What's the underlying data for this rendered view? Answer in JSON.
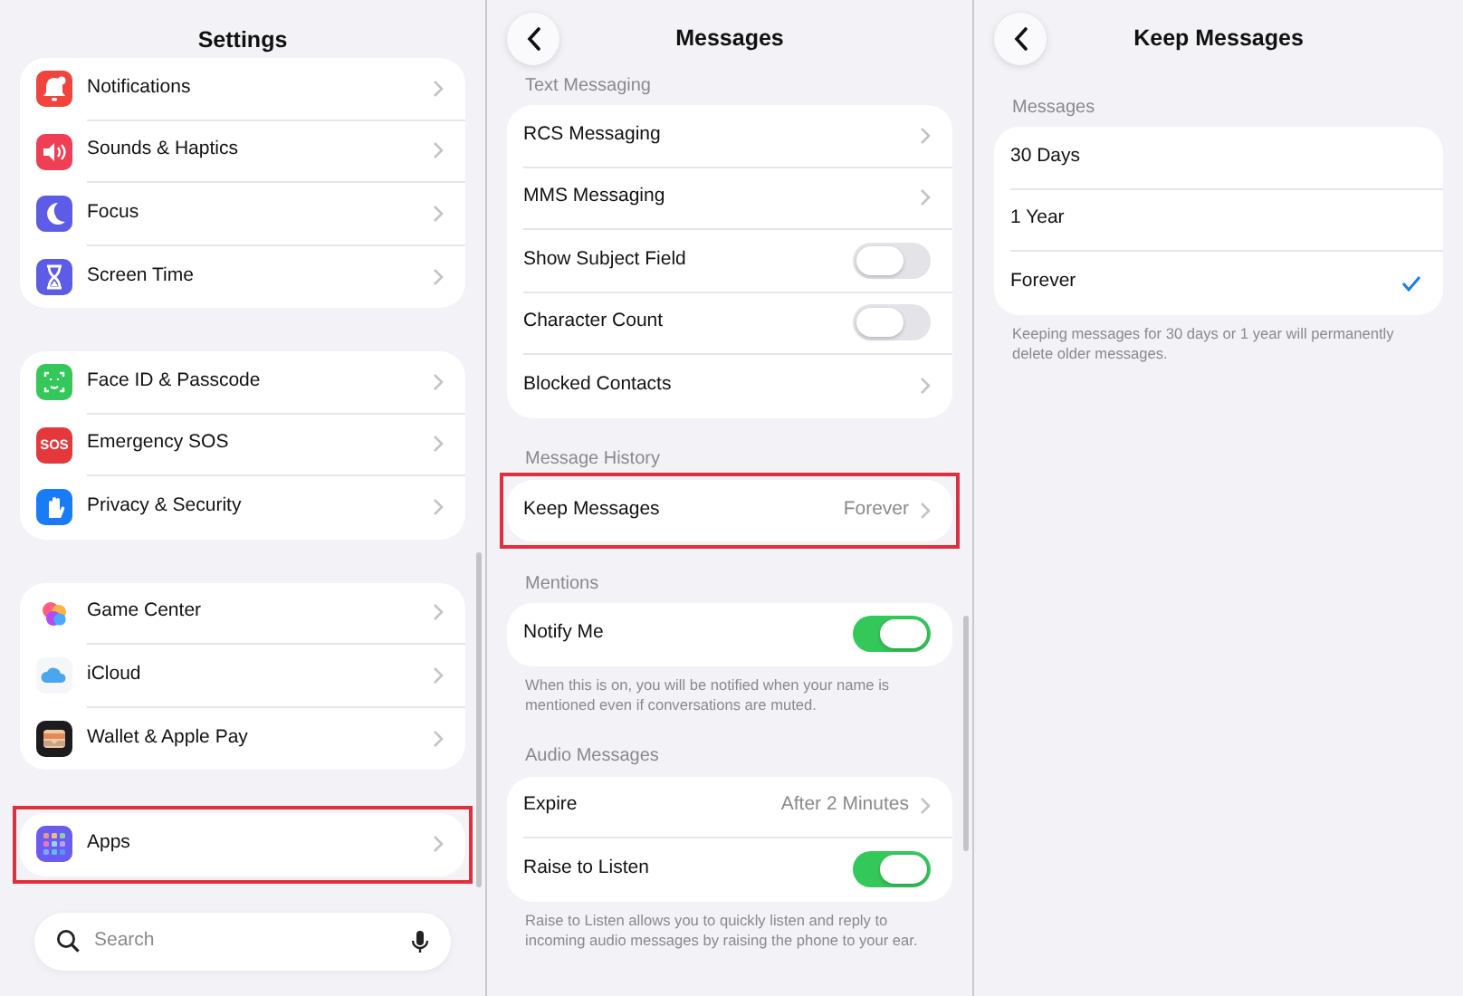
{
  "panels": [
    {
      "title": "Settings",
      "back_button": false,
      "groups": [
        {
          "highlighted": false,
          "rows": [
            {
              "label": "Notifications",
              "kind": "link"
            },
            {
              "label": "Sounds & Haptics",
              "kind": "link"
            },
            {
              "label": "Focus",
              "kind": "link"
            },
            {
              "label": "Screen Time",
              "kind": "link"
            }
          ]
        },
        {
          "highlighted": false,
          "rows": [
            {
              "label": "Face ID & Passcode",
              "kind": "link"
            },
            {
              "label": "Emergency SOS",
              "kind": "link",
              "icon_label": "SOS"
            },
            {
              "label": "Privacy & Security",
              "kind": "link"
            }
          ]
        },
        {
          "highlighted": false,
          "rows": [
            {
              "label": "Game Center",
              "kind": "link"
            },
            {
              "label": "iCloud",
              "kind": "link"
            },
            {
              "label": "Wallet & Apple Pay",
              "kind": "link"
            }
          ]
        },
        {
          "highlighted": true,
          "rows": [
            {
              "label": "Apps",
              "kind": "link"
            }
          ]
        }
      ],
      "search": {
        "placeholder": "Search"
      }
    },
    {
      "title": "Messages",
      "back_button": true,
      "groups": [
        {
          "header": "Text Messaging",
          "rows": [
            {
              "label": "RCS Messaging",
              "kind": "link"
            },
            {
              "label": "MMS Messaging",
              "kind": "link"
            },
            {
              "label": "Show Subject Field",
              "kind": "toggle",
              "on": false
            },
            {
              "label": "Character Count",
              "kind": "toggle",
              "on": false
            },
            {
              "label": "Blocked Contacts",
              "kind": "link"
            }
          ]
        },
        {
          "header": "Message History",
          "highlighted": true,
          "rows": [
            {
              "label": "Keep Messages",
              "kind": "link",
              "value": "Forever"
            }
          ]
        },
        {
          "header": "Mentions",
          "rows": [
            {
              "label": "Notify Me",
              "kind": "toggle",
              "on": true
            }
          ],
          "footer": "When this is on, you will be notified when your name is mentioned even if conversations are muted."
        },
        {
          "header": "Audio Messages",
          "rows": [
            {
              "label": "Expire",
              "kind": "link",
              "value": "After 2 Minutes"
            },
            {
              "label": "Raise to Listen",
              "kind": "toggle",
              "on": true
            }
          ],
          "footer": "Raise to Listen allows you to quickly listen and reply to incoming audio messages by raising the phone to your ear."
        }
      ]
    },
    {
      "title": "Keep Messages",
      "back_button": true,
      "groups": [
        {
          "header": "Messages",
          "rows": [
            {
              "label": "30 Days",
              "kind": "option",
              "selected": false
            },
            {
              "label": "1 Year",
              "kind": "option",
              "selected": false
            },
            {
              "label": "Forever",
              "kind": "option",
              "selected": true
            }
          ],
          "footer": "Keeping messages for 30 days or 1 year will permanently delete older messages."
        }
      ]
    }
  ]
}
